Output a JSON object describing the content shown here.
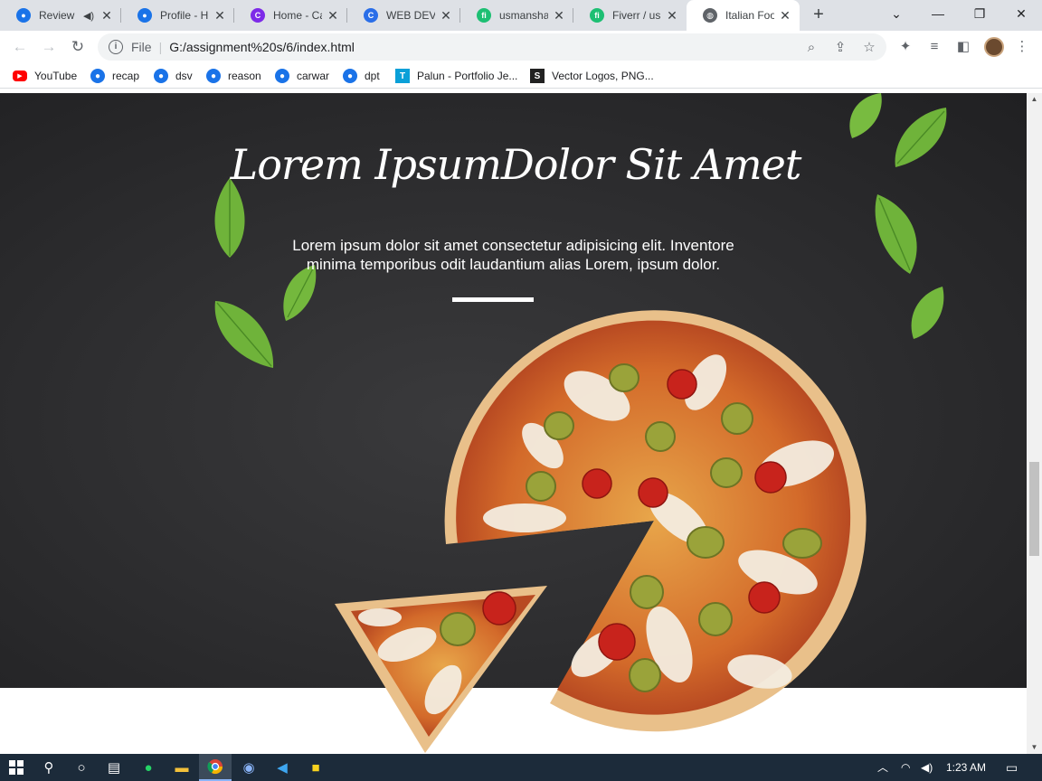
{
  "browser": {
    "tabs": [
      {
        "label": "Review",
        "icon": "brain-icon",
        "audio": true
      },
      {
        "label": "Profile - Hu",
        "icon": "brain-icon"
      },
      {
        "label": "Home - Car",
        "icon": "canva-icon"
      },
      {
        "label": "WEB DEVEL",
        "icon": "canva-icon"
      },
      {
        "label": "usmanshah",
        "icon": "fiverr-icon"
      },
      {
        "label": "Fiverr / usm",
        "icon": "fiverr-icon"
      },
      {
        "label": "Italian Foo",
        "icon": "globe-icon",
        "active": true
      }
    ],
    "address": {
      "scheme": "File",
      "url": "G:/assignment%20s/6/index.html"
    },
    "bookmarks": [
      {
        "label": "YouTube",
        "icon": "youtube-icon"
      },
      {
        "label": "recap",
        "icon": "brain-icon"
      },
      {
        "label": "dsv",
        "icon": "brain-icon"
      },
      {
        "label": "reason",
        "icon": "brain-icon"
      },
      {
        "label": "carwar",
        "icon": "brain-icon"
      },
      {
        "label": "dpt",
        "icon": "brain-icon"
      },
      {
        "label": "Palun - Portfolio Je...",
        "icon": "t-icon"
      },
      {
        "label": "Vector Logos, PNG...",
        "icon": "s-icon"
      }
    ]
  },
  "hero": {
    "title": "Lorem IpsumDolor Sit Amet",
    "subtitle": "Lorem ipsum dolor sit amet consectetur adipisicing elit. Inventore minima temporibus odit laudantium alias Lorem, ipsum dolor.",
    "background_color": "#2c2c2e"
  },
  "taskbar": {
    "clock": "1:23 AM",
    "apps": [
      "windows-icon",
      "search-icon",
      "cortana-icon",
      "task-view-icon",
      "whatsapp-icon",
      "file-explorer-icon",
      "chrome-icon",
      "brain-app-icon",
      "vscode-icon",
      "sticky-notes-icon"
    ]
  },
  "colors": {
    "leaf": "#6fb33a",
    "crust": "#e9b877",
    "sauce": "#d2622a",
    "cheese": "#f4ede0",
    "olive": "#9aa33a",
    "tomato": "#c8231c"
  }
}
